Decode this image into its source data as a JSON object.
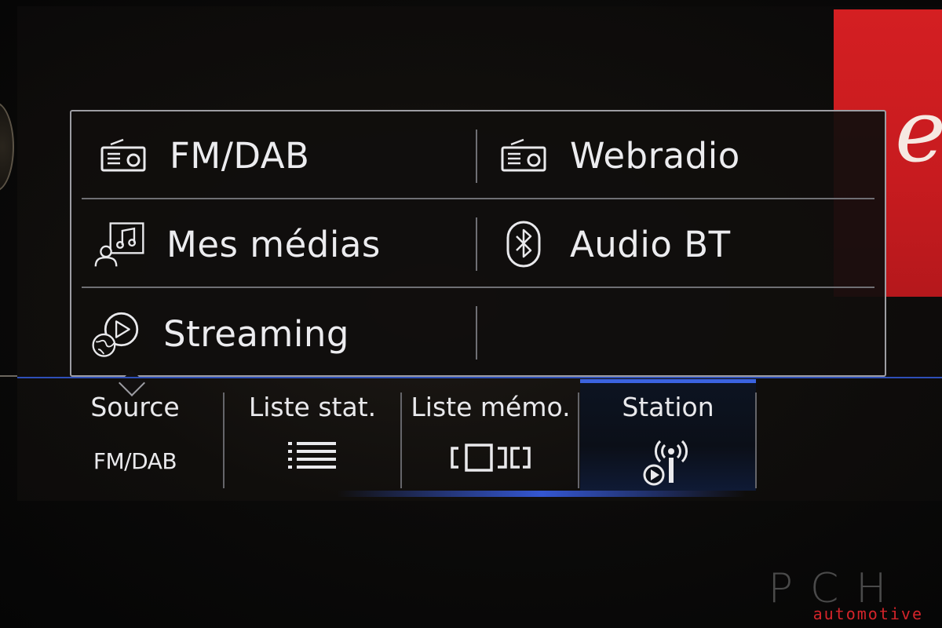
{
  "source_menu": {
    "items": [
      {
        "label": "FM/DAB",
        "icon": "radio-icon"
      },
      {
        "label": "Webradio",
        "icon": "webradio-icon"
      },
      {
        "label": "Mes médias",
        "icon": "my-media-icon"
      },
      {
        "label": "Audio BT",
        "icon": "bluetooth-icon"
      },
      {
        "label": "Streaming",
        "icon": "streaming-icon"
      }
    ]
  },
  "bottom_bar": {
    "tabs": [
      {
        "title": "Source",
        "sub": "FM/DAB",
        "icon": null,
        "active": false
      },
      {
        "title": "Liste stat.",
        "icon": "list-icon",
        "active": false
      },
      {
        "title": "Liste mémo.",
        "icon": "presets-icon",
        "active": false
      },
      {
        "title": "Station",
        "icon": "station-antenna-icon",
        "active": true
      }
    ]
  },
  "watermark": {
    "brand": "PCH",
    "tagline": "automotive"
  },
  "colors": {
    "accent_blue": "#3b63e0",
    "cover_red": "#d41f22",
    "watermark_red": "#d4242a"
  }
}
